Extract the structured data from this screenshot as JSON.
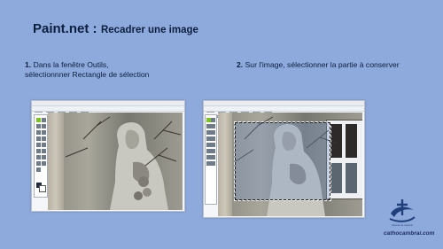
{
  "title": {
    "main": "Paint.net :",
    "subtitle": "Recadrer une image"
  },
  "step1": {
    "number": "1.",
    "line1": "Dans la fenêtre Outils,",
    "line2": "sélectionnner Rectangle de sélection"
  },
  "step2": {
    "number": "2.",
    "text": "Sur l'image, sélectionner la partie à conserver"
  },
  "logo": {
    "caption": "diocèse de cambrai"
  },
  "site": "cathocambrai.com",
  "colors": {
    "background": "#8ea9dc",
    "title_text": "#0b1f3f",
    "selected_tool": "#7fbf2a"
  }
}
